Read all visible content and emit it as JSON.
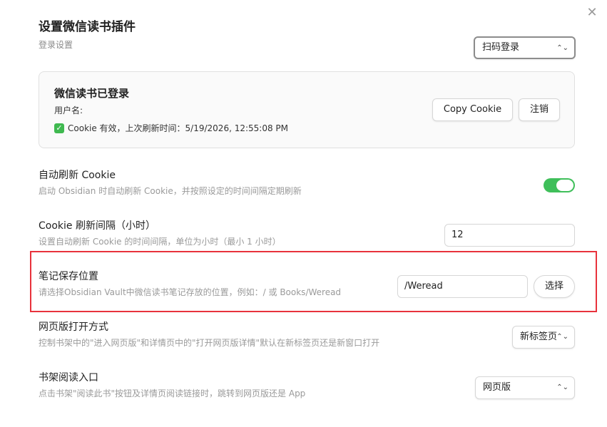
{
  "header": {
    "title": "设置微信读书插件",
    "subtitle": "登录设置",
    "close_icon": "close-icon",
    "login_select": "扫码登录"
  },
  "account_card": {
    "title": "微信读书已登录",
    "username_label": "用户名:",
    "status_icon": "check-icon",
    "status_text": "Cookie 有效，上次刷新时间：5/19/2026, 12:55:08 PM",
    "copy_button": "Copy Cookie",
    "logout_button": "注销"
  },
  "settings": {
    "auto_refresh": {
      "name": "自动刷新 Cookie",
      "desc": "启动 Obsidian 时自动刷新 Cookie，并按照设定的时间间隔定期刷新",
      "enabled": true
    },
    "interval": {
      "name": "Cookie 刷新间隔（小时）",
      "desc": "设置自动刷新 Cookie 的时间间隔，单位为小时（最小 1 小时）",
      "value": "12"
    },
    "save_location": {
      "name": "笔记保存位置",
      "desc": "请选择Obsidian Vault中微信读书笔记存放的位置，例如：/ 或 Books/Weread",
      "value": "/Weread",
      "button": "选择"
    },
    "web_open": {
      "name": "网页版打开方式",
      "desc": "控制书架中的\"进入网页版\"和详情页中的\"打开网页版详情\"默认在新标签页还是新窗口打开",
      "value": "新标签页"
    },
    "shelf_entry": {
      "name": "书架阅读入口",
      "desc": "点击书架\"阅读此书\"按钮及详情页阅读链接时，跳转到网页版还是 App",
      "value": "网页版"
    }
  },
  "colors": {
    "toggle_on": "#3fbf5a",
    "highlight_border": "#e8323c"
  }
}
